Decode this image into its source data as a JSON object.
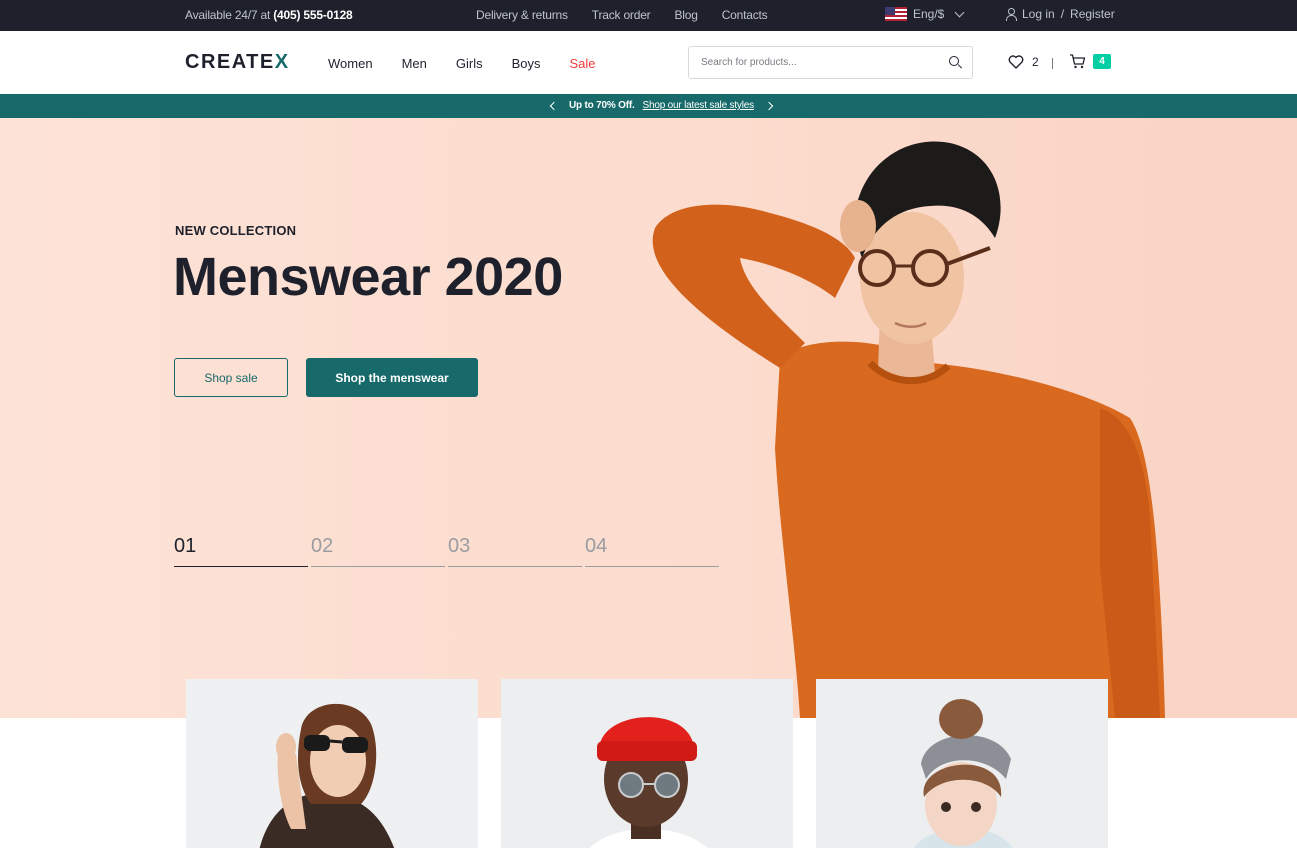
{
  "topbar": {
    "availability_prefix": "Available 24/7 at",
    "phone": "(405) 555-0128",
    "links": [
      "Delivery & returns",
      "Track order",
      "Blog",
      "Contacts"
    ],
    "language": "Eng/$",
    "login": "Log in",
    "separator": "/",
    "register": "Register"
  },
  "header": {
    "logo_main": "CREATE",
    "logo_accent": "X",
    "nav": [
      "Women",
      "Men",
      "Girls",
      "Boys",
      "Sale"
    ],
    "search_placeholder": "Search for products...",
    "wishlist_count": "2",
    "cart_count": "4"
  },
  "promo": {
    "bold": "Up to 70% Off.",
    "link": "Shop our latest sale styles"
  },
  "hero": {
    "eyebrow": "NEW COLLECTION",
    "title": "Menswear 2020",
    "btn_secondary": "Shop sale",
    "btn_primary": "Shop the menswear",
    "slides": [
      "01",
      "02",
      "03",
      "04"
    ],
    "active_slide": "01"
  },
  "colors": {
    "dark": "#1e212c",
    "primary": "#17696a",
    "accent_green": "#03cea4",
    "sale_red": "#f03d3d",
    "hero_bg": "#fde2d6",
    "sweater": "#d9691f"
  },
  "icons": [
    "us-flag-icon",
    "chevron-down-icon",
    "user-icon",
    "search-icon",
    "heart-icon",
    "cart-icon",
    "arrow-left-icon",
    "arrow-right-icon"
  ]
}
